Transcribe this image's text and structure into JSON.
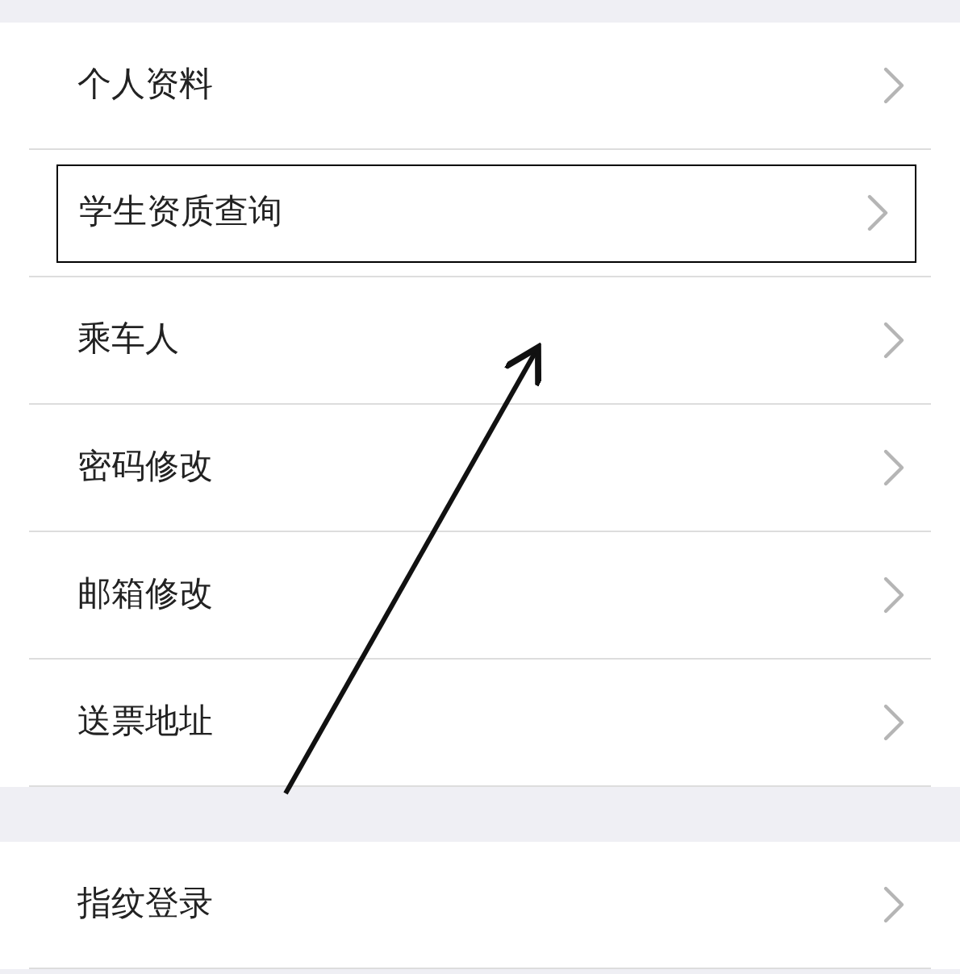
{
  "sections": [
    {
      "items": [
        {
          "label": "个人资料",
          "highlighted": false
        },
        {
          "label": "学生资质查询",
          "highlighted": true
        },
        {
          "label": "乘车人",
          "highlighted": false
        },
        {
          "label": "密码修改",
          "highlighted": false
        },
        {
          "label": "邮箱修改",
          "highlighted": false
        },
        {
          "label": "送票地址",
          "highlighted": false
        }
      ]
    },
    {
      "items": [
        {
          "label": "指纹登录",
          "highlighted": false
        }
      ]
    }
  ]
}
